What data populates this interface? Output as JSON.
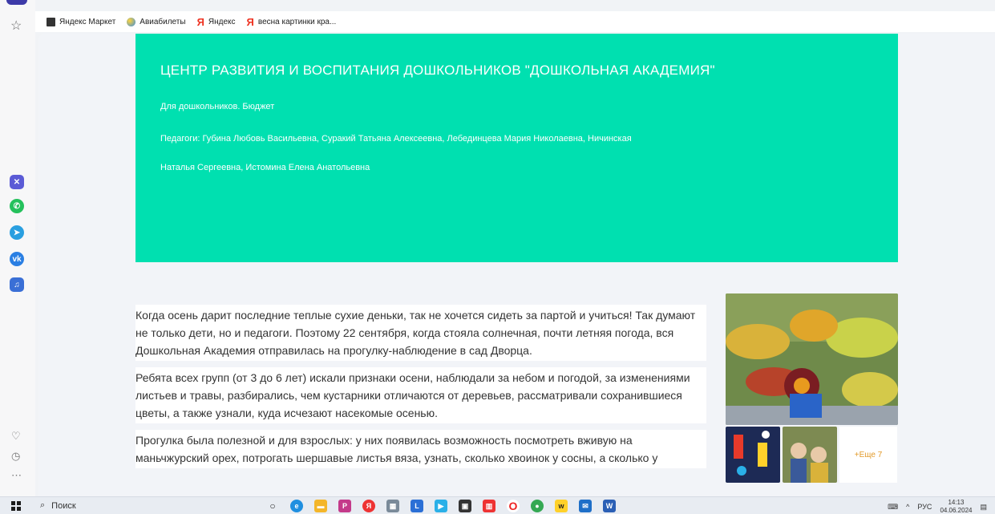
{
  "bookmarks": [
    {
      "label": "Яндекс Маркет",
      "icon": "doc-icon"
    },
    {
      "label": "Авиабилеты",
      "icon": "globe-icon"
    },
    {
      "label": "Яндекс",
      "icon": "yandex-icon"
    },
    {
      "label": "весна картинки кра...",
      "icon": "yandex-icon"
    }
  ],
  "banner": {
    "title": "ЦЕНТР РАЗВИТИЯ И ВОСПИТАНИЯ ДОШКОЛЬНИКОВ \"ДОШКОЛЬНАЯ АКАДЕМИЯ\"",
    "subtitle": "Для дошкольников. Бюджет",
    "teachers_line1": "Педагоги: Губина Любовь Васильевна, Суракий Татьяна Алексеевна, Лебединцева Мария Николаевна, Ничинская",
    "teachers_line2": "Наталья Сергеевна, Истомина Елена Анатольевна",
    "color": "#00e0b0"
  },
  "article": {
    "p1": "Когда осень дарит последние теплые сухие деньки, так не хочется сидеть за партой и учиться! Так думают не только дети, но и педагоги. Поэтому 22 сентября, когда стояла солнечная, почти летняя погода, вся Дошкольная Академия отправилась на прогулку-наблюдение в сад Дворца.",
    "p2": "Ребята всех групп (от 3 до 6 лет) искали признаки осени, наблюдали за небом и погодой, за изменениями листьев и травы, разбирались, чем кустарники отличаются от деревьев, рассматривали сохранившиеся цветы, а также узнали, куда исчезают насекомые осенью.",
    "p3": "Прогулка была полезной и для взрослых: у них появилась возможность посмотреть вживую на маньчжурский орех, потрогать шершавые листья вяза, узнать, сколько хвоинок у сосны, а сколько у"
  },
  "gallery": {
    "more_label": "+Еще 7"
  },
  "taskbar": {
    "search_label": "Поиск",
    "lang": "РУС",
    "time": "14:13",
    "date": "04.06.2024"
  }
}
